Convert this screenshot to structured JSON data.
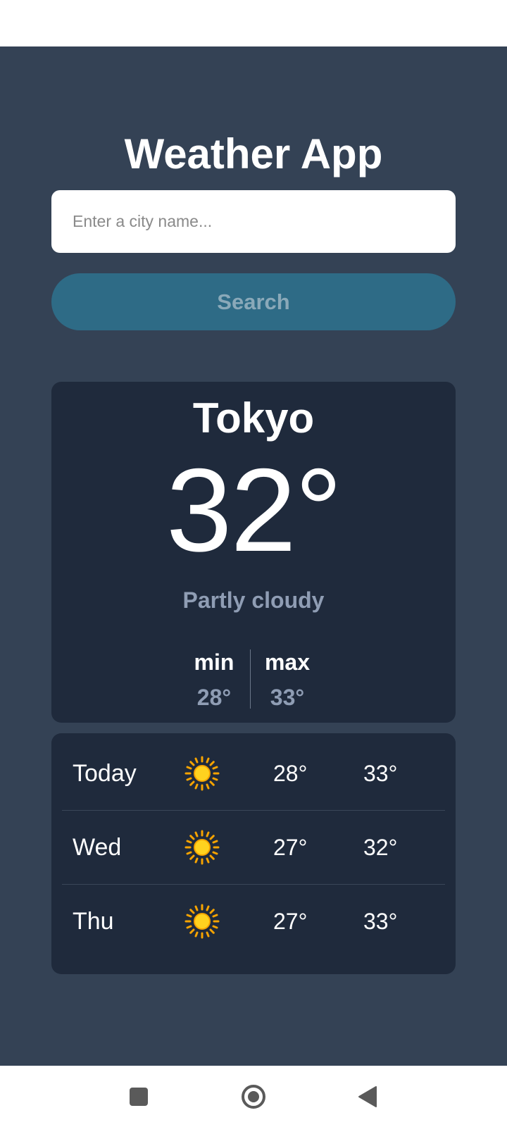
{
  "app": {
    "title": "Weather App",
    "background_color": "#344255",
    "card_color": "#1f2a3c",
    "accent_color": "#2e6b86"
  },
  "search": {
    "placeholder": "Enter a city name...",
    "value": "",
    "button_label": "Search"
  },
  "current": {
    "city": "Tokyo",
    "temperature": "32°",
    "condition": "Partly cloudy",
    "min_label": "min",
    "min_value": "28°",
    "max_label": "max",
    "max_value": "33°"
  },
  "forecast": [
    {
      "day": "Today",
      "icon": "sun-icon",
      "min": "28°",
      "max": "33°"
    },
    {
      "day": "Wed",
      "icon": "sun-icon",
      "min": "27°",
      "max": "32°"
    },
    {
      "day": "Thu",
      "icon": "sun-icon",
      "min": "27°",
      "max": "33°"
    }
  ],
  "navigation": {
    "recents_icon": "square-icon",
    "home_icon": "circle-home-icon",
    "back_icon": "triangle-back-icon"
  }
}
